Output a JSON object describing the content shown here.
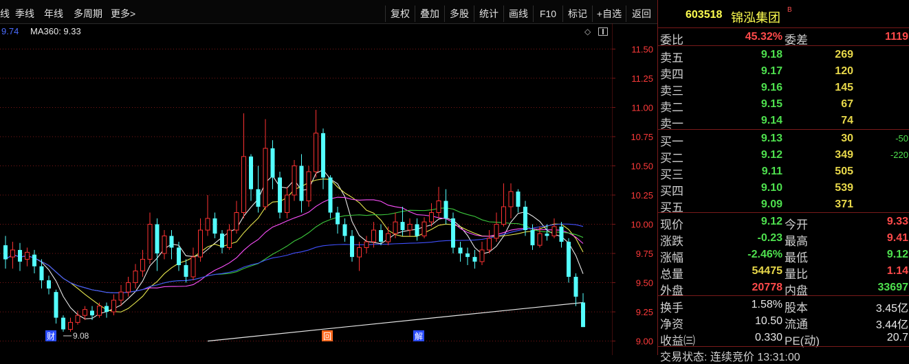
{
  "top_tabs": [
    {
      "label": "线"
    },
    {
      "label": "季线"
    },
    {
      "label": "年线"
    },
    {
      "label": "多周期"
    },
    {
      "label": "更多>"
    }
  ],
  "toolbar": [
    {
      "label": "复权"
    },
    {
      "label": "叠加"
    },
    {
      "label": "多股"
    },
    {
      "label": "统计"
    },
    {
      "label": "画线"
    },
    {
      "label": "F10"
    },
    {
      "label": "标记"
    },
    {
      "label": "+自选"
    },
    {
      "label": "返回"
    }
  ],
  "indicators": {
    "ma_prev": "9.74",
    "ma360": "MA360: 9.33"
  },
  "axis_ticks": [
    "11.50",
    "11.25",
    "11.00",
    "10.75",
    "10.50",
    "10.25",
    "10.00",
    "9.75",
    "9.50",
    "9.25",
    "9.00"
  ],
  "low_marker": "9.08",
  "event_markers": [
    {
      "label": "财"
    },
    {
      "label": "回"
    },
    {
      "label": "解"
    }
  ],
  "colors": {
    "up": "#ff3232",
    "down": "#54ffff",
    "ma_white": "#e8e8e8",
    "ma_yellow": "#e8e84e",
    "ma_magenta": "#ff50ff",
    "ma_green": "#3cc83c",
    "ma_blue": "#4050ff",
    "grid": "#801818"
  },
  "stock": {
    "code": "603518",
    "name": "锦泓集团",
    "badge": "B"
  },
  "weibi": {
    "label": "委比",
    "value": "45.32%",
    "label2": "委差",
    "value2": "1119"
  },
  "sell": [
    {
      "label": "卖五",
      "price": "9.18",
      "vol": "269"
    },
    {
      "label": "卖四",
      "price": "9.17",
      "vol": "120"
    },
    {
      "label": "卖三",
      "price": "9.16",
      "vol": "145"
    },
    {
      "label": "卖二",
      "price": "9.15",
      "vol": "67"
    },
    {
      "label": "卖一",
      "price": "9.14",
      "vol": "74"
    }
  ],
  "buy": [
    {
      "label": "买一",
      "price": "9.13",
      "vol": "30",
      "chg": "-50"
    },
    {
      "label": "买二",
      "price": "9.12",
      "vol": "349",
      "chg": "-220"
    },
    {
      "label": "买三",
      "price": "9.11",
      "vol": "505",
      "chg": ""
    },
    {
      "label": "买四",
      "price": "9.10",
      "vol": "539",
      "chg": ""
    },
    {
      "label": "买五",
      "price": "9.09",
      "vol": "371",
      "chg": ""
    }
  ],
  "quote": [
    {
      "l1": "现价",
      "v1": "9.12",
      "l2": "今开",
      "v2": "9.33"
    },
    {
      "l1": "涨跌",
      "v1": "-0.23",
      "l2": "最高",
      "v2": "9.41"
    },
    {
      "l1": "涨幅",
      "v1": "-2.46%",
      "l2": "最低",
      "v2": "9.12"
    },
    {
      "l1": "总量",
      "v1": "54475",
      "l2": "量比",
      "v2": "1.14"
    },
    {
      "l1": "外盘",
      "v1": "20778",
      "l2": "内盘",
      "v2": "33697"
    }
  ],
  "fund": [
    {
      "l1": "换手",
      "v1": "1.58%",
      "l2": "股本",
      "v2": "3.45亿"
    },
    {
      "l1": "净资",
      "v1": "10.50",
      "l2": "流通",
      "v2": "3.44亿"
    },
    {
      "l1": "收益㈢",
      "v1": "0.330",
      "l2": "PE(动)",
      "v2": "20.7"
    }
  ],
  "status_partial": "交易状态: 连续竞价 13:31:00",
  "chart_data": {
    "type": "candlestick",
    "ylim": [
      8.88,
      11.72
    ],
    "ticks": [
      11.5,
      11.25,
      11.0,
      10.75,
      10.5,
      10.25,
      10.0,
      9.75,
      9.5,
      9.25,
      9.0
    ],
    "candles": [
      [
        9.82,
        9.7,
        9.9,
        9.62
      ],
      [
        9.72,
        9.78,
        9.85,
        9.62
      ],
      [
        9.78,
        9.68,
        9.84,
        9.6
      ],
      [
        9.7,
        9.76,
        9.8,
        9.64
      ],
      [
        9.74,
        9.64,
        9.78,
        9.58
      ],
      [
        9.64,
        9.52,
        9.7,
        9.45
      ],
      [
        9.52,
        9.45,
        9.56,
        9.4
      ],
      [
        9.42,
        9.2,
        9.44,
        9.15
      ],
      [
        9.2,
        9.1,
        9.22,
        9.08
      ],
      [
        9.1,
        9.16,
        9.2,
        9.08
      ],
      [
        9.16,
        9.22,
        9.26,
        9.14
      ],
      [
        9.22,
        9.27,
        9.3,
        9.18
      ],
      [
        9.26,
        9.22,
        9.3,
        9.18
      ],
      [
        9.22,
        9.3,
        9.33,
        9.2
      ],
      [
        9.3,
        9.25,
        9.33,
        9.2
      ],
      [
        9.25,
        9.35,
        9.4,
        9.22
      ],
      [
        9.35,
        9.42,
        9.48,
        9.3
      ],
      [
        9.42,
        9.5,
        9.55,
        9.38
      ],
      [
        9.5,
        9.6,
        9.66,
        9.45
      ],
      [
        9.6,
        9.7,
        9.78,
        9.55
      ],
      [
        9.7,
        10.0,
        10.1,
        9.66
      ],
      [
        10.0,
        9.75,
        10.05,
        9.6
      ],
      [
        9.75,
        9.9,
        9.95,
        9.7
      ],
      [
        9.9,
        9.8,
        9.95,
        9.7
      ],
      [
        9.8,
        9.65,
        9.85,
        9.6
      ],
      [
        9.65,
        9.55,
        9.7,
        9.5
      ],
      [
        9.55,
        9.72,
        9.8,
        9.52
      ],
      [
        9.72,
        9.95,
        10.05,
        9.68
      ],
      [
        9.95,
        10.05,
        10.25,
        9.9
      ],
      [
        10.05,
        9.92,
        10.1,
        9.88
      ],
      [
        9.92,
        9.8,
        9.95,
        9.75
      ],
      [
        9.8,
        9.95,
        10.0,
        9.78
      ],
      [
        9.95,
        10.1,
        10.2,
        9.92
      ],
      [
        10.1,
        10.58,
        10.95,
        10.05
      ],
      [
        10.58,
        10.3,
        10.6,
        10.2
      ],
      [
        10.3,
        10.15,
        10.5,
        10.1
      ],
      [
        10.15,
        10.65,
        10.9,
        10.12
      ],
      [
        10.65,
        10.4,
        10.72,
        10.3
      ],
      [
        10.4,
        10.1,
        10.45,
        10.05
      ],
      [
        10.1,
        10.25,
        10.32,
        10.05
      ],
      [
        10.25,
        10.5,
        10.55,
        10.2
      ],
      [
        10.5,
        10.2,
        10.6,
        10.1
      ],
      [
        10.2,
        10.45,
        10.5,
        10.15
      ],
      [
        10.45,
        10.78,
        10.98,
        10.4
      ],
      [
        10.78,
        10.4,
        10.82,
        10.3
      ],
      [
        10.4,
        10.1,
        10.42,
        10.05
      ],
      [
        10.1,
        10.0,
        10.15,
        9.92
      ],
      [
        10.0,
        9.9,
        10.05,
        9.85
      ],
      [
        9.9,
        9.72,
        9.95,
        9.68
      ],
      [
        9.72,
        9.8,
        9.85,
        9.6
      ],
      [
        9.8,
        9.85,
        9.9,
        9.75
      ],
      [
        9.85,
        9.95,
        10.02,
        9.8
      ],
      [
        9.95,
        9.85,
        10.0,
        9.82
      ],
      [
        9.85,
        9.92,
        9.98,
        9.82
      ],
      [
        9.92,
        10.02,
        10.1,
        9.88
      ],
      [
        10.02,
        9.95,
        10.15,
        9.9
      ],
      [
        9.95,
        10.0,
        10.05,
        9.9
      ],
      [
        10.0,
        9.9,
        10.05,
        9.86
      ],
      [
        9.9,
        10.02,
        10.06,
        9.88
      ],
      [
        10.02,
        10.1,
        10.18,
        9.98
      ],
      [
        10.1,
        10.2,
        10.32,
        10.05
      ],
      [
        10.2,
        10.05,
        10.3,
        10.0
      ],
      [
        10.05,
        9.8,
        10.1,
        9.75
      ],
      [
        9.8,
        9.75,
        9.85,
        9.68
      ],
      [
        9.75,
        9.72,
        9.8,
        9.65
      ],
      [
        9.72,
        9.68,
        9.78,
        9.62
      ],
      [
        9.68,
        9.78,
        9.85,
        9.65
      ],
      [
        9.78,
        9.88,
        9.95,
        9.75
      ],
      [
        9.88,
        10.0,
        10.1,
        9.85
      ],
      [
        10.0,
        10.15,
        10.35,
        9.98
      ],
      [
        10.15,
        10.28,
        10.35,
        10.05
      ],
      [
        10.28,
        10.15,
        10.3,
        10.1
      ],
      [
        10.15,
        9.95,
        10.2,
        9.9
      ],
      [
        9.95,
        9.82,
        10.0,
        9.78
      ],
      [
        9.82,
        9.92,
        9.98,
        9.8
      ],
      [
        9.92,
        9.9,
        10.0,
        9.86
      ],
      [
        9.9,
        9.98,
        10.05,
        9.88
      ],
      [
        9.98,
        9.85,
        10.02,
        9.8
      ],
      [
        9.85,
        9.55,
        9.88,
        9.5
      ],
      [
        9.55,
        9.38,
        9.58,
        9.3
      ],
      [
        9.33,
        9.12,
        9.41,
        9.12
      ]
    ],
    "ma360_start_value": 9.0,
    "ma360_end_value": 9.33
  }
}
